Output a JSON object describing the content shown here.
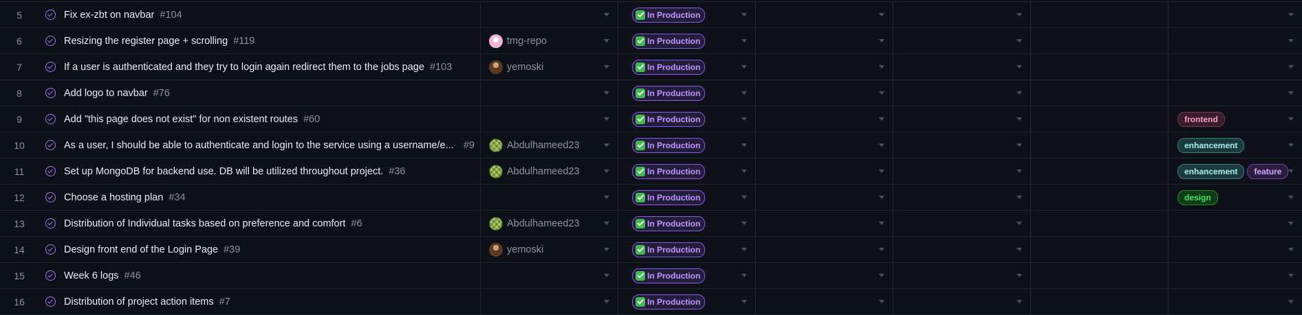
{
  "status_label": "In Production",
  "rows": [
    {
      "n": "5",
      "title": "Fix ex-zbt on navbar",
      "num": "#104",
      "assignee": "",
      "avatar": "",
      "labels": []
    },
    {
      "n": "6",
      "title": "Resizing the register page + scrolling",
      "num": "#119",
      "assignee": "tmg-repo",
      "avatar": "tmg",
      "labels": []
    },
    {
      "n": "7",
      "title": "If a user is authenticated and they try to login again redirect them to the jobs page",
      "num": "#103",
      "assignee": "yemoski",
      "avatar": "yemoski",
      "labels": []
    },
    {
      "n": "8",
      "title": "Add logo to navbar",
      "num": "#76",
      "assignee": "",
      "avatar": "",
      "labels": []
    },
    {
      "n": "9",
      "title": "Add \"this page does not exist\" for non existent routes",
      "num": "#60",
      "assignee": "",
      "avatar": "",
      "labels": [
        {
          "text": "frontend",
          "cls": "frontend"
        }
      ]
    },
    {
      "n": "10",
      "title": "As a user, I should be able to authenticate and login to the service using a username/e...",
      "num": "#9",
      "assignee": "Abdulhameed23",
      "avatar": "abdul",
      "labels": [
        {
          "text": "enhancement",
          "cls": "enhancement"
        }
      ],
      "trunc": true
    },
    {
      "n": "11",
      "title": "Set up MongoDB for backend use. DB will be utilized throughout project.",
      "num": "#36",
      "assignee": "Abdulhameed23",
      "avatar": "abdul",
      "labels": [
        {
          "text": "enhancement",
          "cls": "enhancement"
        },
        {
          "text": "feature",
          "cls": "feature"
        }
      ]
    },
    {
      "n": "12",
      "title": "Choose a hosting plan",
      "num": "#34",
      "assignee": "",
      "avatar": "",
      "labels": [
        {
          "text": "design",
          "cls": "design"
        }
      ]
    },
    {
      "n": "13",
      "title": "Distribution of Individual tasks based on preference and comfort",
      "num": "#6",
      "assignee": "Abdulhameed23",
      "avatar": "abdul",
      "labels": []
    },
    {
      "n": "14",
      "title": "Design front end of the Login Page",
      "num": "#39",
      "assignee": "yemoski",
      "avatar": "yemoski",
      "labels": []
    },
    {
      "n": "15",
      "title": "Week 6 logs",
      "num": "#46",
      "assignee": "",
      "avatar": "",
      "labels": []
    },
    {
      "n": "16",
      "title": "Distribution of project action items",
      "num": "#7",
      "assignee": "",
      "avatar": "",
      "labels": []
    }
  ]
}
